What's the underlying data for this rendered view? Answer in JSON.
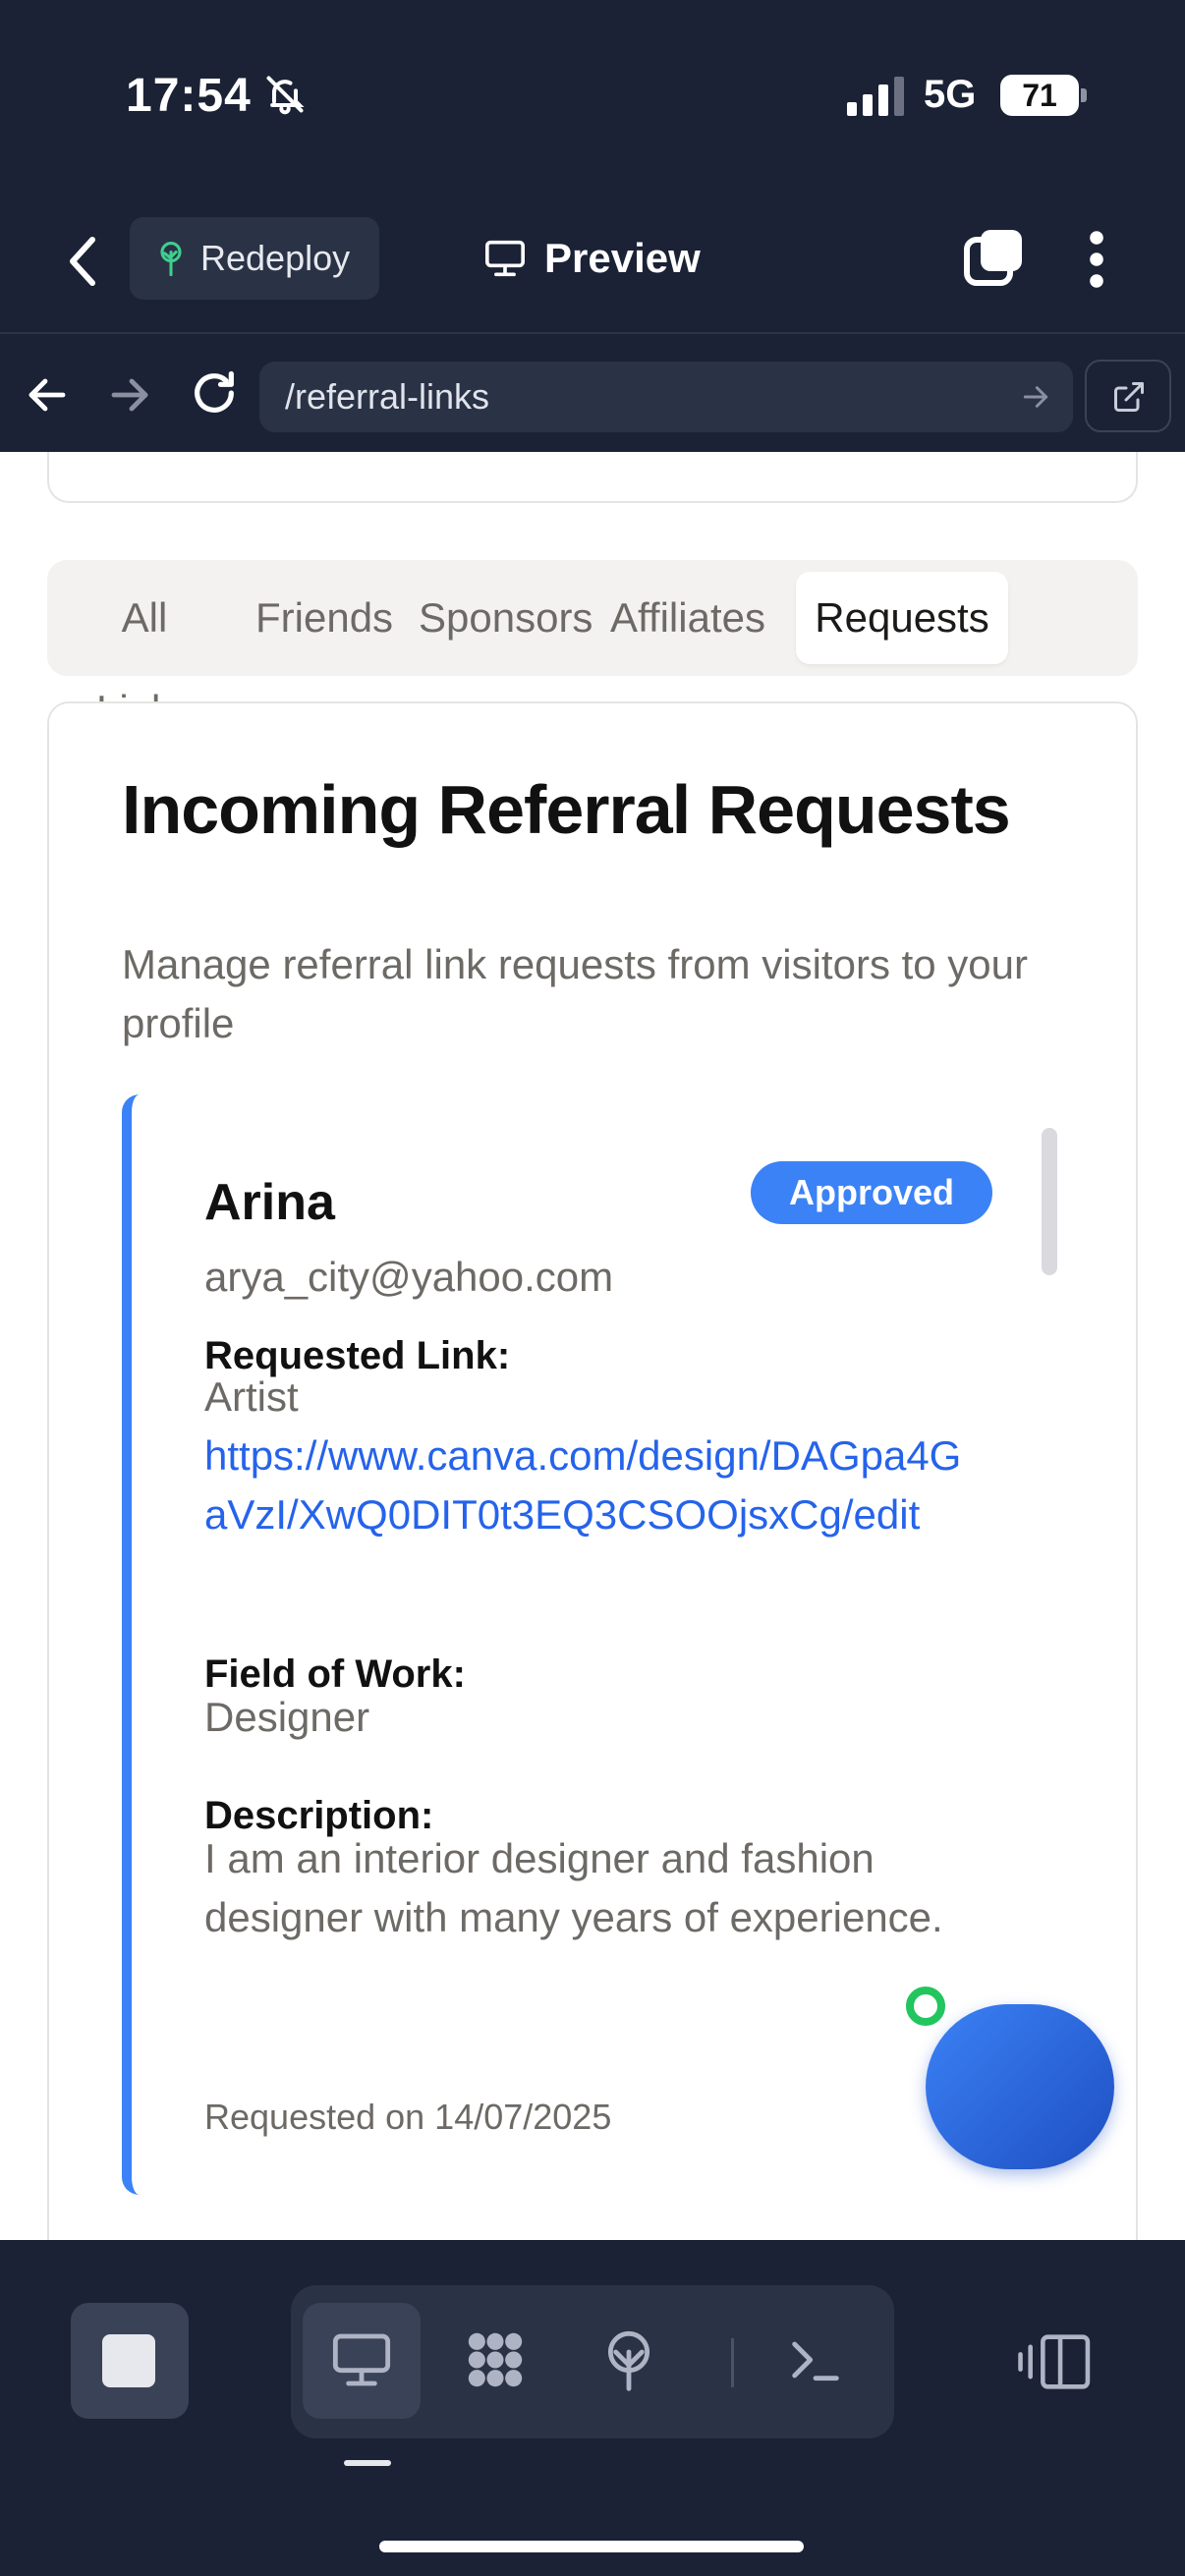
{
  "status_bar": {
    "time": "17:54",
    "network": "5G",
    "battery": "71"
  },
  "toolbar": {
    "redeploy_label": "Redeploy",
    "preview_label": "Preview"
  },
  "browser": {
    "url": "/referral-links"
  },
  "tabs": [
    {
      "label": "All Links",
      "active": false
    },
    {
      "label": "Friends",
      "active": false
    },
    {
      "label": "Sponsors",
      "active": false
    },
    {
      "label": "Affiliates",
      "active": false
    },
    {
      "label": "Requests",
      "active": true
    }
  ],
  "requests_card": {
    "title": "Incoming Referral Requests",
    "subtitle": "Manage referral link requests from visitors to your profile"
  },
  "request": {
    "name": "Arina",
    "status": "Approved",
    "email": "arya_city@yahoo.com",
    "requested_link_label": "Requested Link:",
    "requested_link_type": "Artist",
    "requested_link_url": "https://www.canva.com/design/DAGpa4GaVzI/XwQ0DIT0t3EQ3CSOOjsxCg/edit",
    "field_of_work_label": "Field of Work:",
    "field_of_work": "Designer",
    "description_label": "Description:",
    "description": "I am an interior designer and fashion designer with many years of experience.",
    "requested_on": "Requested on 14/07/2025"
  },
  "colors": {
    "accent": "#3b82f6",
    "link": "#2563eb",
    "chrome_bg": "#1b2236",
    "online": "#22c55e"
  },
  "icons": [
    "bell-slash-icon",
    "signal-icon",
    "chevron-left-icon",
    "tree-icon",
    "monitor-icon",
    "windows-icon",
    "kebab-icon",
    "arrow-left-icon",
    "arrow-right-icon",
    "reload-icon",
    "external-link-icon",
    "stop-icon",
    "grid-icon",
    "antenna-icon",
    "terminal-icon",
    "panel-layout-icon"
  ]
}
